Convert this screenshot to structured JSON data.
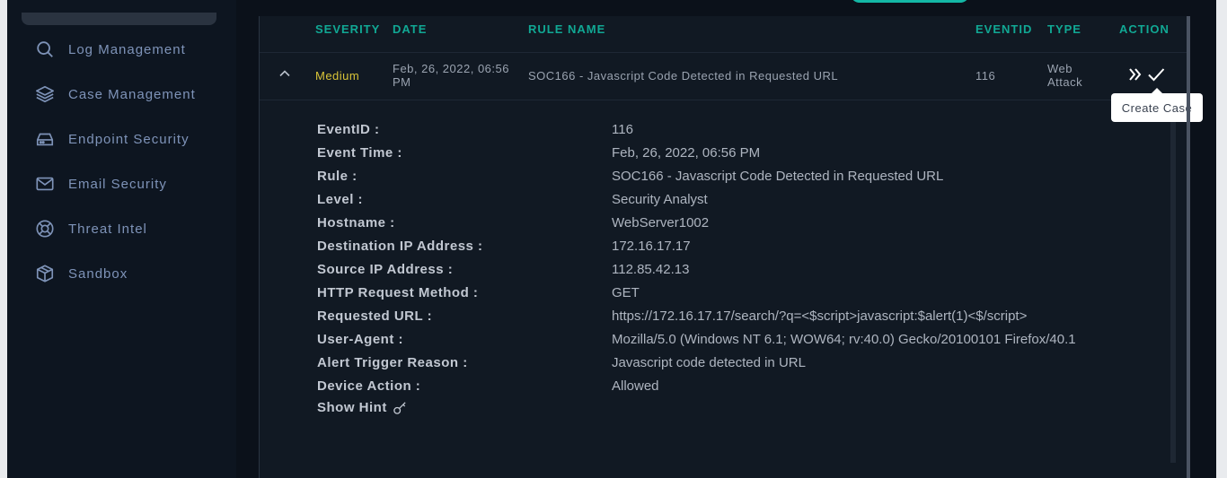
{
  "sidebar": {
    "items": [
      {
        "label": "Log Management",
        "icon": "search-icon"
      },
      {
        "label": "Case Management",
        "icon": "layers-icon"
      },
      {
        "label": "Endpoint Security",
        "icon": "hard-drive-icon"
      },
      {
        "label": "Email Security",
        "icon": "mail-icon"
      },
      {
        "label": "Threat Intel",
        "icon": "lifebuoy-icon"
      },
      {
        "label": "Sandbox",
        "icon": "cube-icon"
      }
    ]
  },
  "table": {
    "headers": {
      "severity": "SEVERITY",
      "date": "DATE",
      "rule_name": "RULE NAME",
      "eventid": "EVENTID",
      "type": "TYPE",
      "action": "ACTION"
    },
    "row": {
      "severity": "Medium",
      "date_line1": "Feb, 26, 2022, 06:56",
      "date_line2": "PM",
      "rule_name": "SOC166 - Javascript Code Detected in Requested URL",
      "eventid": "116",
      "type_line1": "Web",
      "type_line2": "Attack"
    }
  },
  "tooltip": "Create Case",
  "details": [
    {
      "key": "EventID :",
      "value": "116"
    },
    {
      "key": "Event Time :",
      "value": "Feb, 26, 2022, 06:56 PM"
    },
    {
      "key": "Rule :",
      "value": "SOC166 - Javascript Code Detected in Requested URL"
    },
    {
      "key": "Level :",
      "value": "Security Analyst"
    },
    {
      "key": "Hostname :",
      "value": "WebServer1002"
    },
    {
      "key": "Destination IP Address :",
      "value": "172.16.17.17"
    },
    {
      "key": "Source IP Address :",
      "value": "112.85.42.13"
    },
    {
      "key": "HTTP Request Method :",
      "value": "GET"
    },
    {
      "key": "Requested URL :",
      "value": "https://172.16.17.17/search/?q=<$script>javascript:$alert(1)<$/script>"
    },
    {
      "key": "User-Agent :",
      "value": "Mozilla/5.0 (Windows NT 6.1; WOW64; rv:40.0) Gecko/20100101 Firefox/40.1"
    },
    {
      "key": "Alert Trigger Reason :",
      "value": "Javascript code detected in URL"
    },
    {
      "key": "Device Action :",
      "value": "Allowed"
    }
  ],
  "show_hint": "Show Hint",
  "colors": {
    "accent": "#11a894",
    "severity_medium": "#d9c438",
    "nav_text": "#7e93b8",
    "background": "#0b111a"
  }
}
